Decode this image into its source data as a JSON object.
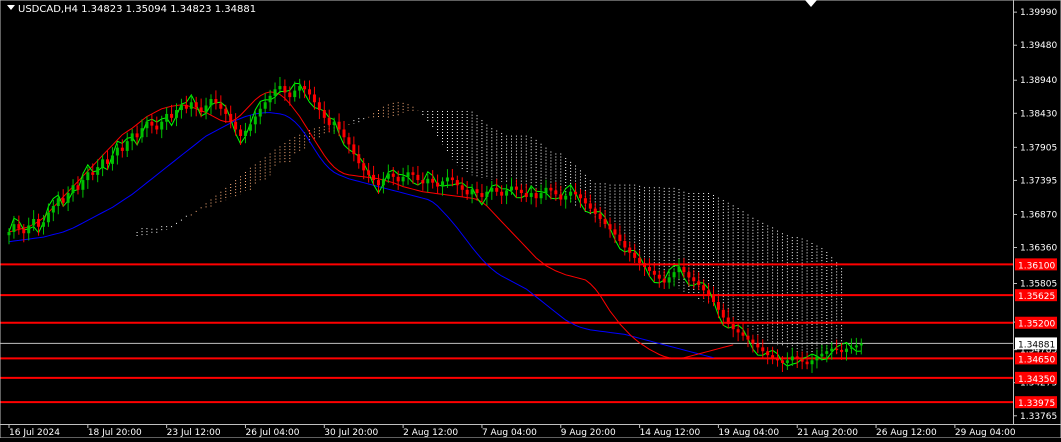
{
  "header": {
    "triangle_icon": "triangle-down-icon",
    "symbol_line": "USDCAD,H4  1.34823 1.35094 1.34823 1.34881"
  },
  "colors": {
    "background": "#000000",
    "bull_candle": "#00c000",
    "bear_candle": "#ff0000",
    "tenkan": "#ff0000",
    "kijun": "#0000ff",
    "chikou": "#00ff00",
    "cloud_up": "#ffb07c",
    "cloud_down": "#ffffff",
    "level_line": "#ff0000",
    "price_line": "#c0c0c0",
    "axis_text": "#ffffff"
  },
  "chart_data": {
    "type": "candlestick",
    "symbol": "USDCAD",
    "timeframe": "H4",
    "ylim": [
      1.372,
      1.4045
    ],
    "y_ticks": [
      1.37765,
      1.38275,
      1.38785,
      1.39295,
      1.39805,
      1.40315,
      1.40825,
      1.41335,
      1.41845,
      1.42355,
      1.42865,
      1.43375,
      1.43885,
      1.44395,
      1.44905
    ],
    "y_tick_labels": [
      "1.33765",
      "1.34275",
      "1.34785",
      "1.35210",
      "1.35805",
      "1.36360",
      "1.36870",
      "1.37395",
      "1.37905",
      "1.38430",
      "1.38940",
      "1.39480",
      "1.39990"
    ],
    "y_tick_values": [
      1.33765,
      1.34275,
      1.34785,
      1.3521,
      1.35805,
      1.3636,
      1.3687,
      1.37395,
      1.37905,
      1.3843,
      1.3894,
      1.3948,
      1.3999
    ],
    "x_tick_labels": [
      "16 Jul 2024",
      "18 Jul 20:00",
      "23 Jul 12:00",
      "26 Jul 04:00",
      "30 Jul 20:00",
      "2 Aug 12:00",
      "7 Aug 04:00",
      "9 Aug 20:00",
      "14 Aug 12:00",
      "19 Aug 04:00",
      "21 Aug 20:00",
      "26 Aug 12:00",
      "29 Aug 04:00"
    ],
    "x_tick_index": [
      0,
      16,
      32,
      48,
      64,
      80,
      96,
      112,
      128,
      144,
      160,
      176,
      192
    ],
    "current_price": 1.34881,
    "current_price_label": "1.34881",
    "levels": [
      {
        "value": 1.361,
        "label": "1.36100"
      },
      {
        "value": 1.35625,
        "label": "1.35625"
      },
      {
        "value": 1.352,
        "label": "1.35200"
      },
      {
        "value": 1.3465,
        "label": "1.34650"
      },
      {
        "value": 1.3435,
        "label": "1.34350"
      },
      {
        "value": 1.33975,
        "label": "1.33975"
      }
    ],
    "close": [
      1.366,
      1.3672,
      1.3665,
      1.3658,
      1.367,
      1.368,
      1.3668,
      1.3675,
      1.369,
      1.37,
      1.3712,
      1.3705,
      1.372,
      1.3732,
      1.3725,
      1.374,
      1.3752,
      1.3748,
      1.376,
      1.3772,
      1.3765,
      1.3778,
      1.379,
      1.3785,
      1.38,
      1.3812,
      1.3806,
      1.382,
      1.383,
      1.3824,
      1.3818,
      1.383,
      1.3842,
      1.3836,
      1.3848,
      1.3856,
      1.385,
      1.386,
      1.3852,
      1.3845,
      1.3855,
      1.3865,
      1.3858,
      1.385,
      1.3842,
      1.383,
      1.3818,
      1.3808,
      1.3816,
      1.3826,
      1.3838,
      1.385,
      1.386,
      1.387,
      1.388,
      1.3885,
      1.3875,
      1.3868,
      1.3878,
      1.3885,
      1.388,
      1.3872,
      1.386,
      1.3848,
      1.3836,
      1.3825,
      1.383,
      1.3818,
      1.3806,
      1.3795,
      1.378,
      1.3766,
      1.3755,
      1.3748,
      1.374,
      1.3732,
      1.3742,
      1.375,
      1.3745,
      1.3738,
      1.3745,
      1.3752,
      1.3748,
      1.374,
      1.3735,
      1.3742,
      1.3736,
      1.373,
      1.3738,
      1.3744,
      1.374,
      1.3732,
      1.3725,
      1.3718,
      1.3726,
      1.372,
      1.3714,
      1.3722,
      1.3728,
      1.3722,
      1.3716,
      1.3724,
      1.373,
      1.3725,
      1.372,
      1.3714,
      1.372,
      1.3712,
      1.372,
      1.3728,
      1.3724,
      1.3718,
      1.371,
      1.3716,
      1.3722,
      1.3718,
      1.3712,
      1.3704,
      1.3696,
      1.3688,
      1.368,
      1.3672,
      1.3664,
      1.3656,
      1.3646,
      1.3636,
      1.3628,
      1.362,
      1.3612,
      1.3606,
      1.36,
      1.3594,
      1.3588,
      1.3582,
      1.359,
      1.3598,
      1.3606,
      1.3598,
      1.359,
      1.3584,
      1.3578,
      1.357,
      1.3562,
      1.3552,
      1.354,
      1.3528,
      1.3518,
      1.351,
      1.3505,
      1.35,
      1.3494,
      1.3488,
      1.3482,
      1.3476,
      1.347,
      1.3466,
      1.3462,
      1.3458,
      1.3462,
      1.3468,
      1.3464,
      1.346,
      1.3456,
      1.3462,
      1.3468,
      1.3472,
      1.3476,
      1.348,
      1.3478,
      1.3475,
      1.348,
      1.3482,
      1.3485,
      1.3488
    ],
    "tenkan": [
      1.366,
      1.3662,
      1.3664,
      1.3666,
      1.3668,
      1.3672,
      1.3676,
      1.3682,
      1.369,
      1.3698,
      1.3706,
      1.3714,
      1.3722,
      1.373,
      1.3738,
      1.3746,
      1.3754,
      1.3762,
      1.377,
      1.3778,
      1.3786,
      1.3794,
      1.3802,
      1.381,
      1.3815,
      1.382,
      1.3826,
      1.3832,
      1.3838,
      1.3842,
      1.3846,
      1.385,
      1.3852,
      1.3854,
      1.3855,
      1.3856,
      1.3855,
      1.3853,
      1.385,
      1.3847,
      1.3844,
      1.384,
      1.3836,
      1.3832,
      1.383,
      1.383,
      1.3834,
      1.384,
      1.3848,
      1.3856,
      1.3864,
      1.387,
      1.3874,
      1.3876,
      1.3875,
      1.3872,
      1.3866,
      1.3858,
      1.3848,
      1.3838,
      1.3826,
      1.3814,
      1.3802,
      1.379,
      1.3778,
      1.3768,
      1.376,
      1.3754,
      1.375,
      1.3748,
      1.3747,
      1.3746,
      1.3745,
      1.3744,
      1.3743,
      1.3742,
      1.374,
      1.3738,
      1.3736,
      1.3733,
      1.373,
      1.3728,
      1.3726,
      1.3724,
      1.3722,
      1.3721,
      1.372,
      1.3719,
      1.3718,
      1.3717,
      1.3716,
      1.3715,
      1.3714,
      1.3713,
      1.3712,
      1.371,
      1.3706,
      1.37,
      1.3692,
      1.3684,
      1.3676,
      1.3668,
      1.366,
      1.3652,
      1.3644,
      1.3636,
      1.3628,
      1.362,
      1.3614,
      1.3608,
      1.3604,
      1.36,
      1.3597,
      1.3594,
      1.3592,
      1.359,
      1.3588,
      1.3586,
      1.358,
      1.3572,
      1.3562,
      1.355,
      1.3538,
      1.3528,
      1.3518,
      1.351,
      1.3502,
      1.3495,
      1.3489,
      1.3484,
      1.3479,
      1.3475,
      1.3471,
      1.3468,
      1.3466,
      1.3465,
      1.3465,
      1.3466,
      1.3468,
      1.347,
      1.3472,
      1.3474,
      1.3476,
      1.3478,
      1.348,
      1.3482,
      1.3484,
      1.3486
    ],
    "kijun": [
      1.3645,
      1.3646,
      1.3647,
      1.3648,
      1.3649,
      1.365,
      1.3651,
      1.3652,
      1.3654,
      1.3656,
      1.3658,
      1.366,
      1.3663,
      1.3666,
      1.367,
      1.3674,
      1.3678,
      1.3682,
      1.3686,
      1.369,
      1.3694,
      1.3698,
      1.3703,
      1.3708,
      1.3713,
      1.3718,
      1.3724,
      1.373,
      1.3736,
      1.3742,
      1.3748,
      1.3754,
      1.376,
      1.3766,
      1.3772,
      1.3778,
      1.3784,
      1.379,
      1.3796,
      1.3802,
      1.3808,
      1.3812,
      1.3816,
      1.382,
      1.3824,
      1.3828,
      1.3832,
      1.3835,
      1.3838,
      1.384,
      1.3842,
      1.3843,
      1.3844,
      1.3844,
      1.3843,
      1.3842,
      1.384,
      1.3836,
      1.383,
      1.3822,
      1.3812,
      1.38,
      1.3788,
      1.3776,
      1.3766,
      1.3758,
      1.3752,
      1.3748,
      1.3745,
      1.3742,
      1.374,
      1.3738,
      1.3736,
      1.3734,
      1.3732,
      1.373,
      1.3728,
      1.3726,
      1.3724,
      1.3722,
      1.372,
      1.3718,
      1.3716,
      1.3714,
      1.3712,
      1.371,
      1.3706,
      1.37,
      1.3692,
      1.3684,
      1.3675,
      1.3666,
      1.3656,
      1.3646,
      1.3636,
      1.3627,
      1.3618,
      1.361,
      1.3603,
      1.3597,
      1.3592,
      1.3588,
      1.3584,
      1.358,
      1.3576,
      1.3572,
      1.3566,
      1.356,
      1.3554,
      1.3548,
      1.3542,
      1.3536,
      1.353,
      1.3524,
      1.352,
      1.3516,
      1.3513,
      1.3511,
      1.3509,
      1.3508,
      1.3507,
      1.3506,
      1.3505,
      1.3504,
      1.3503,
      1.3502,
      1.35,
      1.3498,
      1.3496,
      1.3494,
      1.3492,
      1.349,
      1.3488,
      1.3486,
      1.3484,
      1.3482,
      1.348,
      1.3478,
      1.3476,
      1.3474,
      1.3472,
      1.347,
      1.3468,
      1.3466
    ]
  }
}
